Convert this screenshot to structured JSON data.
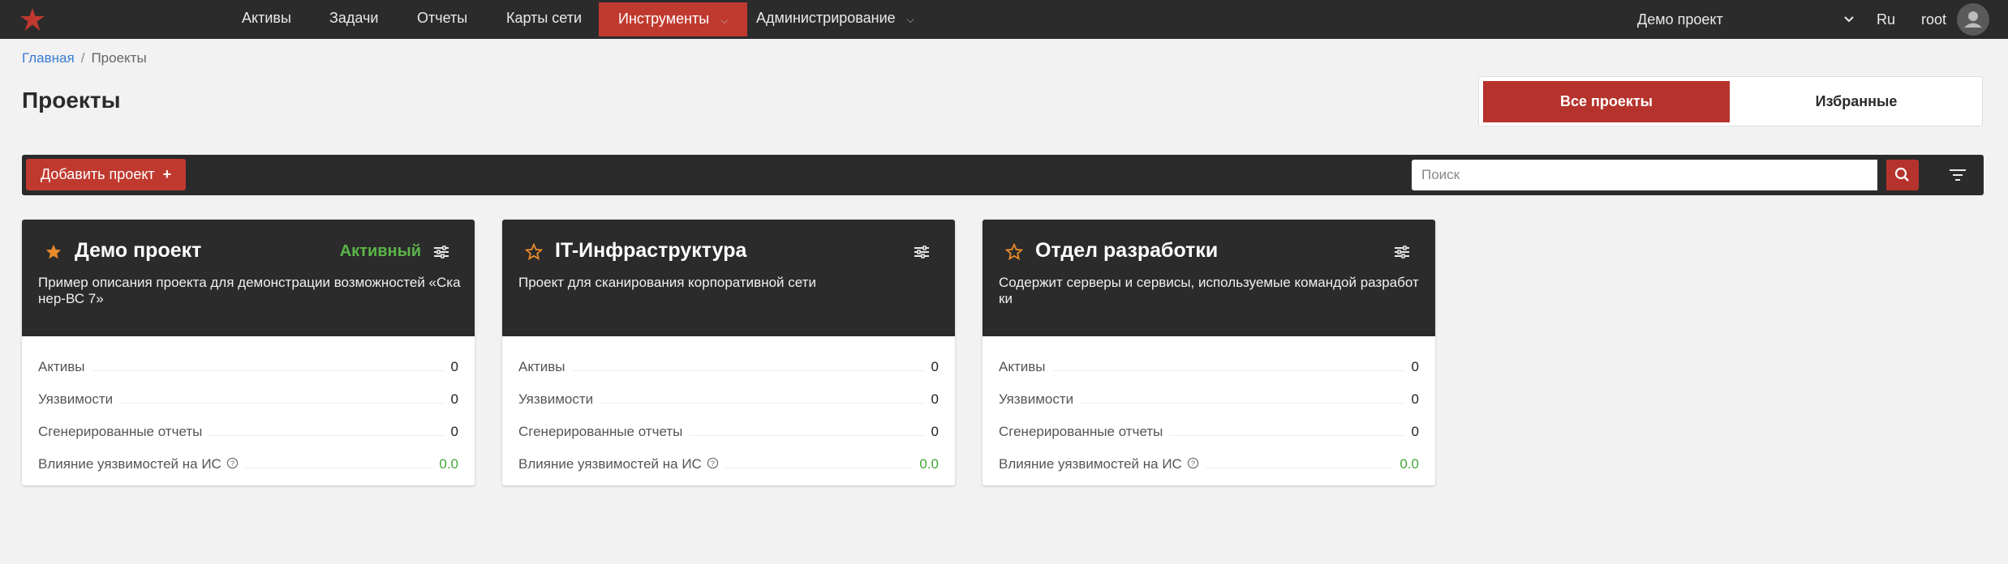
{
  "nav": {
    "items": [
      {
        "label": "Активы"
      },
      {
        "label": "Задачи"
      },
      {
        "label": "Отчеты"
      },
      {
        "label": "Карты сети"
      },
      {
        "label": "Инструменты"
      },
      {
        "label": "Администрирование"
      }
    ],
    "project": "Демо проект",
    "lang": "Ru",
    "user": "root",
    "logo_icon": "star-logo-icon",
    "accent": "#c0392f"
  },
  "breadcrumb": {
    "home": "Главная",
    "current": "Проекты"
  },
  "page_title": "Проекты",
  "tabs": {
    "all": "Все проекты",
    "favorites": "Избранные"
  },
  "toolbar": {
    "add_label": "Добавить проект",
    "search_placeholder": "Поиск"
  },
  "metric_labels": {
    "assets": "Активы",
    "vulns": "Уязвимости",
    "reports": "Сгенерированные отчеты",
    "impact": "Влияние уязвимостей на ИС"
  },
  "projects": [
    {
      "title": "Демо проект",
      "status": "Активный",
      "favorite": true,
      "description": "Пример описания проекта для демонстрации возможностей «Сканер-ВС 7»",
      "assets": "0",
      "vulns": "0",
      "reports": "0",
      "impact": "0.0"
    },
    {
      "title": "IT-Инфраструктура",
      "status": "",
      "favorite": false,
      "description": "Проект для сканирования корпоративной сети",
      "assets": "0",
      "vulns": "0",
      "reports": "0",
      "impact": "0.0"
    },
    {
      "title": "Отдел разработки",
      "status": "",
      "favorite": false,
      "description": "Содержит серверы и сервисы, используемые командой разработки",
      "assets": "0",
      "vulns": "0",
      "reports": "0",
      "impact": "0.0"
    }
  ]
}
